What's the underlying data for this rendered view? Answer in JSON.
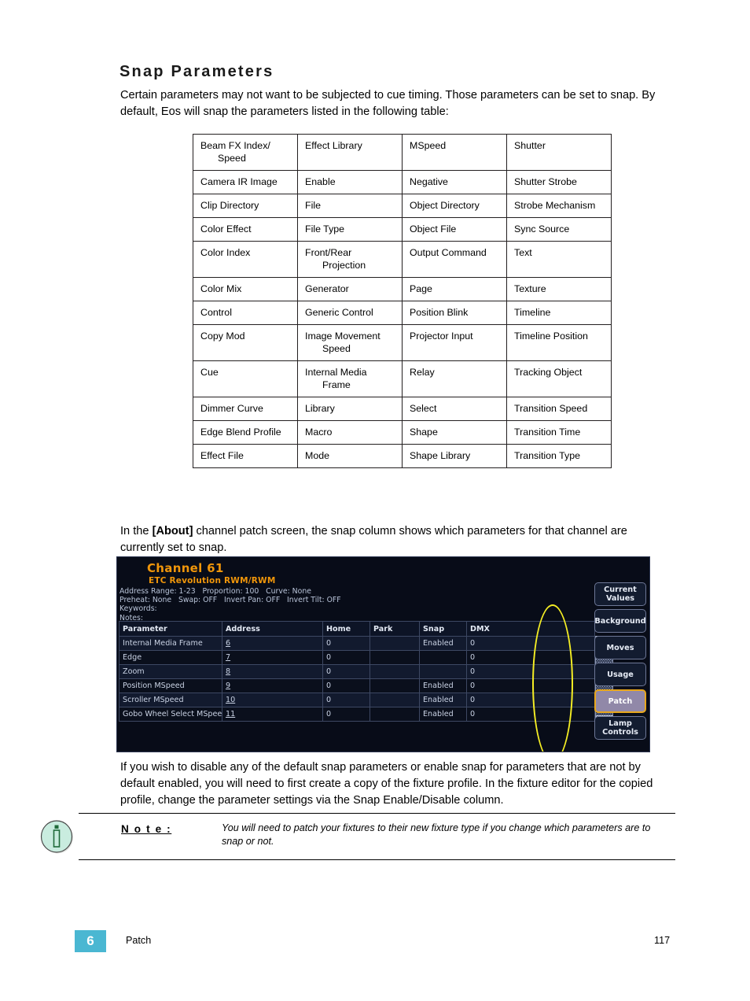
{
  "page": {
    "heading": "Snap Parameters",
    "intro": "Certain parameters may not want to be subjected to cue timing. Those parameters can be set to snap. By default, Eos will snap the parameters listed in the following table:",
    "mid_before": "In the ",
    "mid_bold": "[About]",
    "mid_after": " channel patch screen, the snap column shows which parameters for that channel are currently set to snap.",
    "lower": "If you wish to disable any of the default snap parameters or enable snap for parameters that are not by default enabled, you will need to first create a copy of the fixture profile. In the fixture editor for the copied profile, change the parameter settings via the Snap Enable/Disable column."
  },
  "snap_table": {
    "rows": [
      [
        "Beam FX Index/ Speed",
        "Effect Library",
        "MSpeed",
        "Shutter"
      ],
      [
        "Camera IR Image",
        "Enable",
        "Negative",
        "Shutter Strobe"
      ],
      [
        "Clip Directory",
        "File",
        "Object Directory",
        "Strobe Mechanism"
      ],
      [
        "Color Effect",
        "File Type",
        "Object File",
        "Sync Source"
      ],
      [
        "Color Index",
        "Front/Rear Projection",
        "Output Command",
        "Text"
      ],
      [
        "Color Mix",
        "Generator",
        "Page",
        "Texture"
      ],
      [
        "Control",
        "Generic Control",
        "Position Blink",
        "Timeline"
      ],
      [
        "Copy Mod",
        "Image Movement Speed",
        "Projector Input",
        "Timeline Position"
      ],
      [
        "Cue",
        "Internal Media Frame",
        "Relay",
        "Tracking Object"
      ],
      [
        "Dimmer Curve",
        "Library",
        "Select",
        "Transition Speed"
      ],
      [
        "Edge Blend Profile",
        "Macro",
        "Shape",
        "Transition Time"
      ],
      [
        "Effect File",
        "Mode",
        "Shape Library",
        "Transition Type"
      ]
    ]
  },
  "eos": {
    "channel_title": "Channel 61",
    "fixture_type": "ETC Revolution RWM/RWM",
    "meta_line1": "Address Range: 1-23   Proportion: 100   Curve: None",
    "meta_line2": "Preheat: None   Swap: OFF   Invert Pan: OFF   Invert Tilt: OFF",
    "meta_line3": "Keywords:",
    "meta_line4": "Notes:",
    "columns": [
      "Parameter",
      "Address",
      "Home",
      "Park",
      "Snap",
      "DMX"
    ],
    "rows": [
      {
        "parameter": "Internal Media Frame",
        "address": "6",
        "home": "0",
        "park": "",
        "snap": "Enabled",
        "dmx": "0"
      },
      {
        "parameter": "Edge",
        "address": "7",
        "home": "0",
        "park": "",
        "snap": "",
        "dmx": "0"
      },
      {
        "parameter": "Zoom",
        "address": "8",
        "home": "0",
        "park": "",
        "snap": "",
        "dmx": "0"
      },
      {
        "parameter": "Position MSpeed",
        "address": "9",
        "home": "0",
        "park": "",
        "snap": "Enabled",
        "dmx": "0"
      },
      {
        "parameter": "Scroller MSpeed",
        "address": "10",
        "home": "0",
        "park": "",
        "snap": "Enabled",
        "dmx": "0"
      },
      {
        "parameter": "Gobo Wheel Select MSpeed",
        "address": "11",
        "home": "0",
        "park": "",
        "snap": "Enabled",
        "dmx": "0"
      }
    ],
    "scroll_up": "˄",
    "scroll_down": "˅",
    "buttons": [
      {
        "label": "Current Values",
        "active": false
      },
      {
        "label": "Background",
        "active": false
      },
      {
        "label": "Moves",
        "active": false
      },
      {
        "label": "Usage",
        "active": false
      },
      {
        "label": "Patch",
        "active": true
      },
      {
        "label": "Lamp Controls",
        "active": false
      }
    ],
    "colors": {
      "title_orange": "#f0960a",
      "annotation_yellow": "#f5ee24",
      "active_button": "#9188a8",
      "active_button_border": "#e8a71c"
    }
  },
  "note": {
    "label": "N o t e :",
    "text": "You will need to patch your fixtures to their new fixture type if you change which parameters are to snap or not."
  },
  "footer": {
    "chapter": "6",
    "section": "Patch",
    "page_number": "117",
    "badge_color": "#4ab7d2"
  }
}
